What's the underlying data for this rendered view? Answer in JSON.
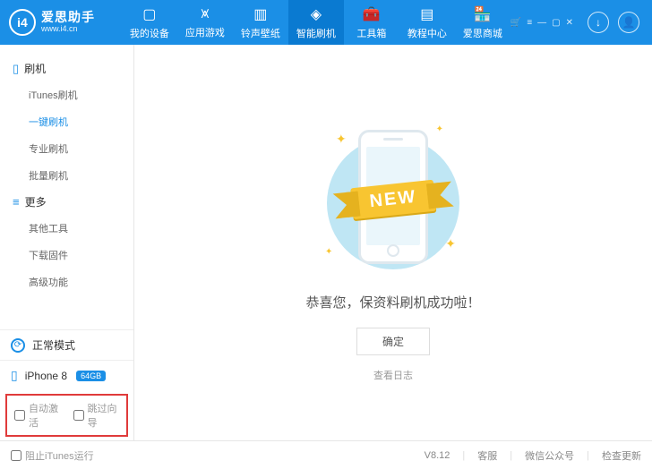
{
  "app": {
    "name": "爱思助手",
    "url": "www.i4.cn",
    "logo_text": "i4"
  },
  "nav": [
    {
      "label": "我的设备",
      "icon": "▢"
    },
    {
      "label": "应用游戏",
      "icon": "⩙"
    },
    {
      "label": "铃声壁纸",
      "icon": "▥"
    },
    {
      "label": "智能刷机",
      "icon": "◈",
      "active": true
    },
    {
      "label": "工具箱",
      "icon": "🧰"
    },
    {
      "label": "教程中心",
      "icon": "▤"
    },
    {
      "label": "爱思商城",
      "icon": "🏪"
    }
  ],
  "tree": {
    "g1": {
      "title": "刷机",
      "items": [
        {
          "label": "iTunes刷机"
        },
        {
          "label": "一键刷机",
          "sel": true
        },
        {
          "label": "专业刷机"
        },
        {
          "label": "批量刷机"
        }
      ]
    },
    "g2": {
      "title": "更多",
      "items": [
        {
          "label": "其他工具"
        },
        {
          "label": "下载固件"
        },
        {
          "label": "高级功能"
        }
      ]
    }
  },
  "mode": {
    "label": "正常模式"
  },
  "device": {
    "name": "iPhone 8",
    "storage": "64GB"
  },
  "checks": {
    "auto": "自动激活",
    "skip": "跳过向导"
  },
  "main": {
    "ribbon": "NEW",
    "message": "恭喜您，保资料刷机成功啦！",
    "ok": "确定",
    "log": "查看日志"
  },
  "footer": {
    "block": "阻止iTunes运行",
    "version": "V8.12",
    "cs": "客服",
    "wx": "微信公众号",
    "upd": "检查更新"
  }
}
